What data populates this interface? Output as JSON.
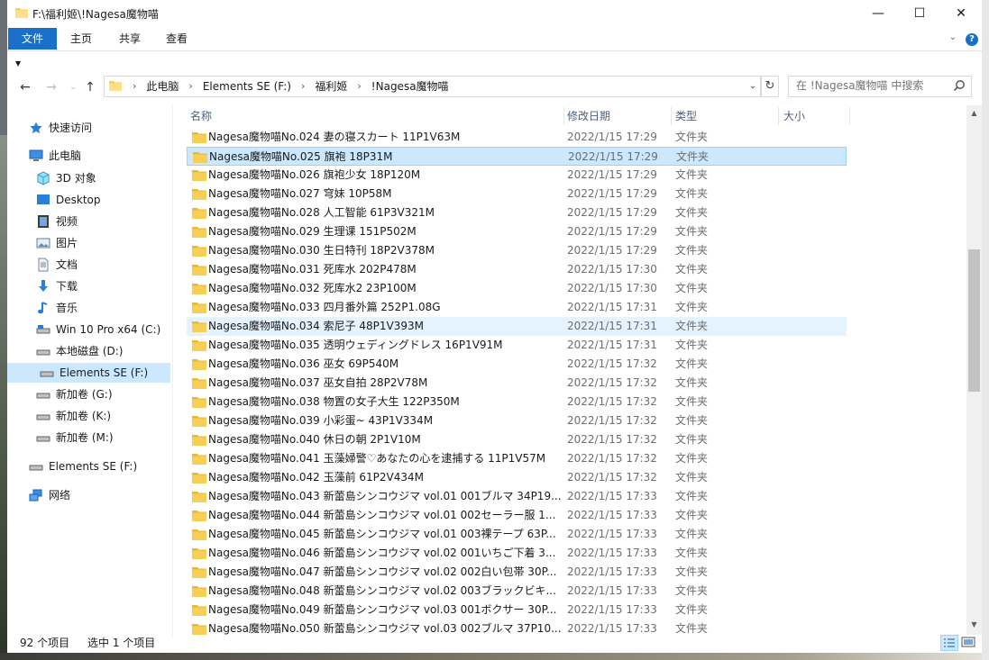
{
  "window": {
    "title": "F:\\福利姬\\!Nagesa魔物喵"
  },
  "window_buttons": {
    "minimize": "—",
    "maximize": "☐",
    "close": "✕"
  },
  "ribbon": {
    "tabs": [
      {
        "label": "文件"
      },
      {
        "label": "主页"
      },
      {
        "label": "共享"
      },
      {
        "label": "查看"
      }
    ]
  },
  "address": {
    "crumbs": [
      "此电脑",
      "Elements SE (F:)",
      "福利姬",
      "!Nagesa魔物喵"
    ]
  },
  "search": {
    "placeholder": "在 !Nagesa魔物喵 中搜索"
  },
  "nav_pane": {
    "items": [
      {
        "label": "快速访问",
        "icon": "star-icon"
      },
      {
        "label": "此电脑",
        "icon": "computer-icon"
      },
      {
        "label": "3D 对象",
        "icon": "cube-icon"
      },
      {
        "label": "Desktop",
        "icon": "desktop-icon"
      },
      {
        "label": "视频",
        "icon": "video-icon"
      },
      {
        "label": "图片",
        "icon": "picture-icon"
      },
      {
        "label": "文档",
        "icon": "document-icon"
      },
      {
        "label": "下载",
        "icon": "download-icon"
      },
      {
        "label": "音乐",
        "icon": "music-icon"
      },
      {
        "label": "Win 10 Pro x64 (C:)",
        "icon": "drive-icon"
      },
      {
        "label": "本地磁盘 (D:)",
        "icon": "drive-icon"
      },
      {
        "label": "Elements SE (F:)",
        "icon": "drive-icon"
      },
      {
        "label": "新加卷 (G:)",
        "icon": "drive-icon"
      },
      {
        "label": "新加卷 (K:)",
        "icon": "drive-icon"
      },
      {
        "label": "新加卷 (M:)",
        "icon": "drive-icon"
      },
      {
        "label": "Elements SE (F:)",
        "icon": "drive-icon"
      },
      {
        "label": "网络",
        "icon": "network-icon"
      }
    ]
  },
  "columns": {
    "name": "名称",
    "date": "修改日期",
    "type": "类型",
    "size": "大小"
  },
  "files": [
    {
      "name": "Nagesa魔物喵No.024 妻の寝スカート 11P1V63M",
      "date": "2022/1/15 17:29",
      "type": "文件夹"
    },
    {
      "name": "Nagesa魔物喵No.025 旗袍 18P31M",
      "date": "2022/1/15 17:29",
      "type": "文件夹"
    },
    {
      "name": "Nagesa魔物喵No.026 旗袍少女 18P120M",
      "date": "2022/1/15 17:29",
      "type": "文件夹"
    },
    {
      "name": "Nagesa魔物喵No.027 穹妹 10P58M",
      "date": "2022/1/15 17:29",
      "type": "文件夹"
    },
    {
      "name": "Nagesa魔物喵No.028 人工智能 61P3V321M",
      "date": "2022/1/15 17:29",
      "type": "文件夹"
    },
    {
      "name": "Nagesa魔物喵No.029 生理课 151P502M",
      "date": "2022/1/15 17:29",
      "type": "文件夹"
    },
    {
      "name": "Nagesa魔物喵No.030 生日特刊 18P2V378M",
      "date": "2022/1/15 17:29",
      "type": "文件夹"
    },
    {
      "name": "Nagesa魔物喵No.031 死库水 202P478M",
      "date": "2022/1/15 17:30",
      "type": "文件夹"
    },
    {
      "name": "Nagesa魔物喵No.032 死库水2 23P100M",
      "date": "2022/1/15 17:30",
      "type": "文件夹"
    },
    {
      "name": "Nagesa魔物喵No.033 四月番外篇 252P1.08G",
      "date": "2022/1/15 17:31",
      "type": "文件夹"
    },
    {
      "name": "Nagesa魔物喵No.034 索尼子 48P1V393M",
      "date": "2022/1/15 17:31",
      "type": "文件夹"
    },
    {
      "name": "Nagesa魔物喵No.035 透明ウェディングドレス 16P1V91M",
      "date": "2022/1/15 17:31",
      "type": "文件夹"
    },
    {
      "name": "Nagesa魔物喵No.036 巫女 69P540M",
      "date": "2022/1/15 17:32",
      "type": "文件夹"
    },
    {
      "name": "Nagesa魔物喵No.037 巫女自拍 28P2V78M",
      "date": "2022/1/15 17:32",
      "type": "文件夹"
    },
    {
      "name": "Nagesa魔物喵No.038 物置の女子大生 122P350M",
      "date": "2022/1/15 17:32",
      "type": "文件夹"
    },
    {
      "name": "Nagesa魔物喵No.039 小彩蛋~ 43P1V334M",
      "date": "2022/1/15 17:32",
      "type": "文件夹"
    },
    {
      "name": "Nagesa魔物喵No.040 休日の朝 2P1V10M",
      "date": "2022/1/15 17:32",
      "type": "文件夹"
    },
    {
      "name": "Nagesa魔物喵No.041 玉藻婦警♡あなたの心を逮捕する 11P1V57M",
      "date": "2022/1/15 17:32",
      "type": "文件夹"
    },
    {
      "name": "Nagesa魔物喵No.042 玉藻前 61P2V434M",
      "date": "2022/1/15 17:32",
      "type": "文件夹"
    },
    {
      "name": "Nagesa魔物喵No.043 新蕾島シンコウジマ vol.01 001ブルマ 34P19...",
      "date": "2022/1/15 17:33",
      "type": "文件夹"
    },
    {
      "name": "Nagesa魔物喵No.044 新蕾島シンコウジマ vol.01 002セーラー服 1...",
      "date": "2022/1/15 17:33",
      "type": "文件夹"
    },
    {
      "name": "Nagesa魔物喵No.045 新蕾島シンコウジマ vol.01 003裸テープ 63P...",
      "date": "2022/1/15 17:33",
      "type": "文件夹"
    },
    {
      "name": "Nagesa魔物喵No.046 新蕾島シンコウジマ vol.02 001いちご下着 3...",
      "date": "2022/1/15 17:33",
      "type": "文件夹"
    },
    {
      "name": "Nagesa魔物喵No.047 新蕾島シンコウジマ vol.02 002白い包帯 30P...",
      "date": "2022/1/15 17:33",
      "type": "文件夹"
    },
    {
      "name": "Nagesa魔物喵No.048 新蕾島シンコウジマ vol.02 003ブラックビキ...",
      "date": "2022/1/15 17:33",
      "type": "文件夹"
    },
    {
      "name": "Nagesa魔物喵No.049 新蕾島シンコウジマ vol.03 001ボクサー 30P...",
      "date": "2022/1/15 17:33",
      "type": "文件夹"
    },
    {
      "name": "Nagesa魔物喵No.050 新蕾島シンコウジマ vol.03 002ブルマ 37P10...",
      "date": "2022/1/15 17:33",
      "type": "文件夹"
    }
  ],
  "status": {
    "count": "92 个项目",
    "selected": "选中 1 个项目"
  },
  "colors": {
    "accent": "#1a6fc9",
    "selection": "#cce8ff",
    "hover": "#e5f3ff",
    "folder": "#f6cf57"
  }
}
